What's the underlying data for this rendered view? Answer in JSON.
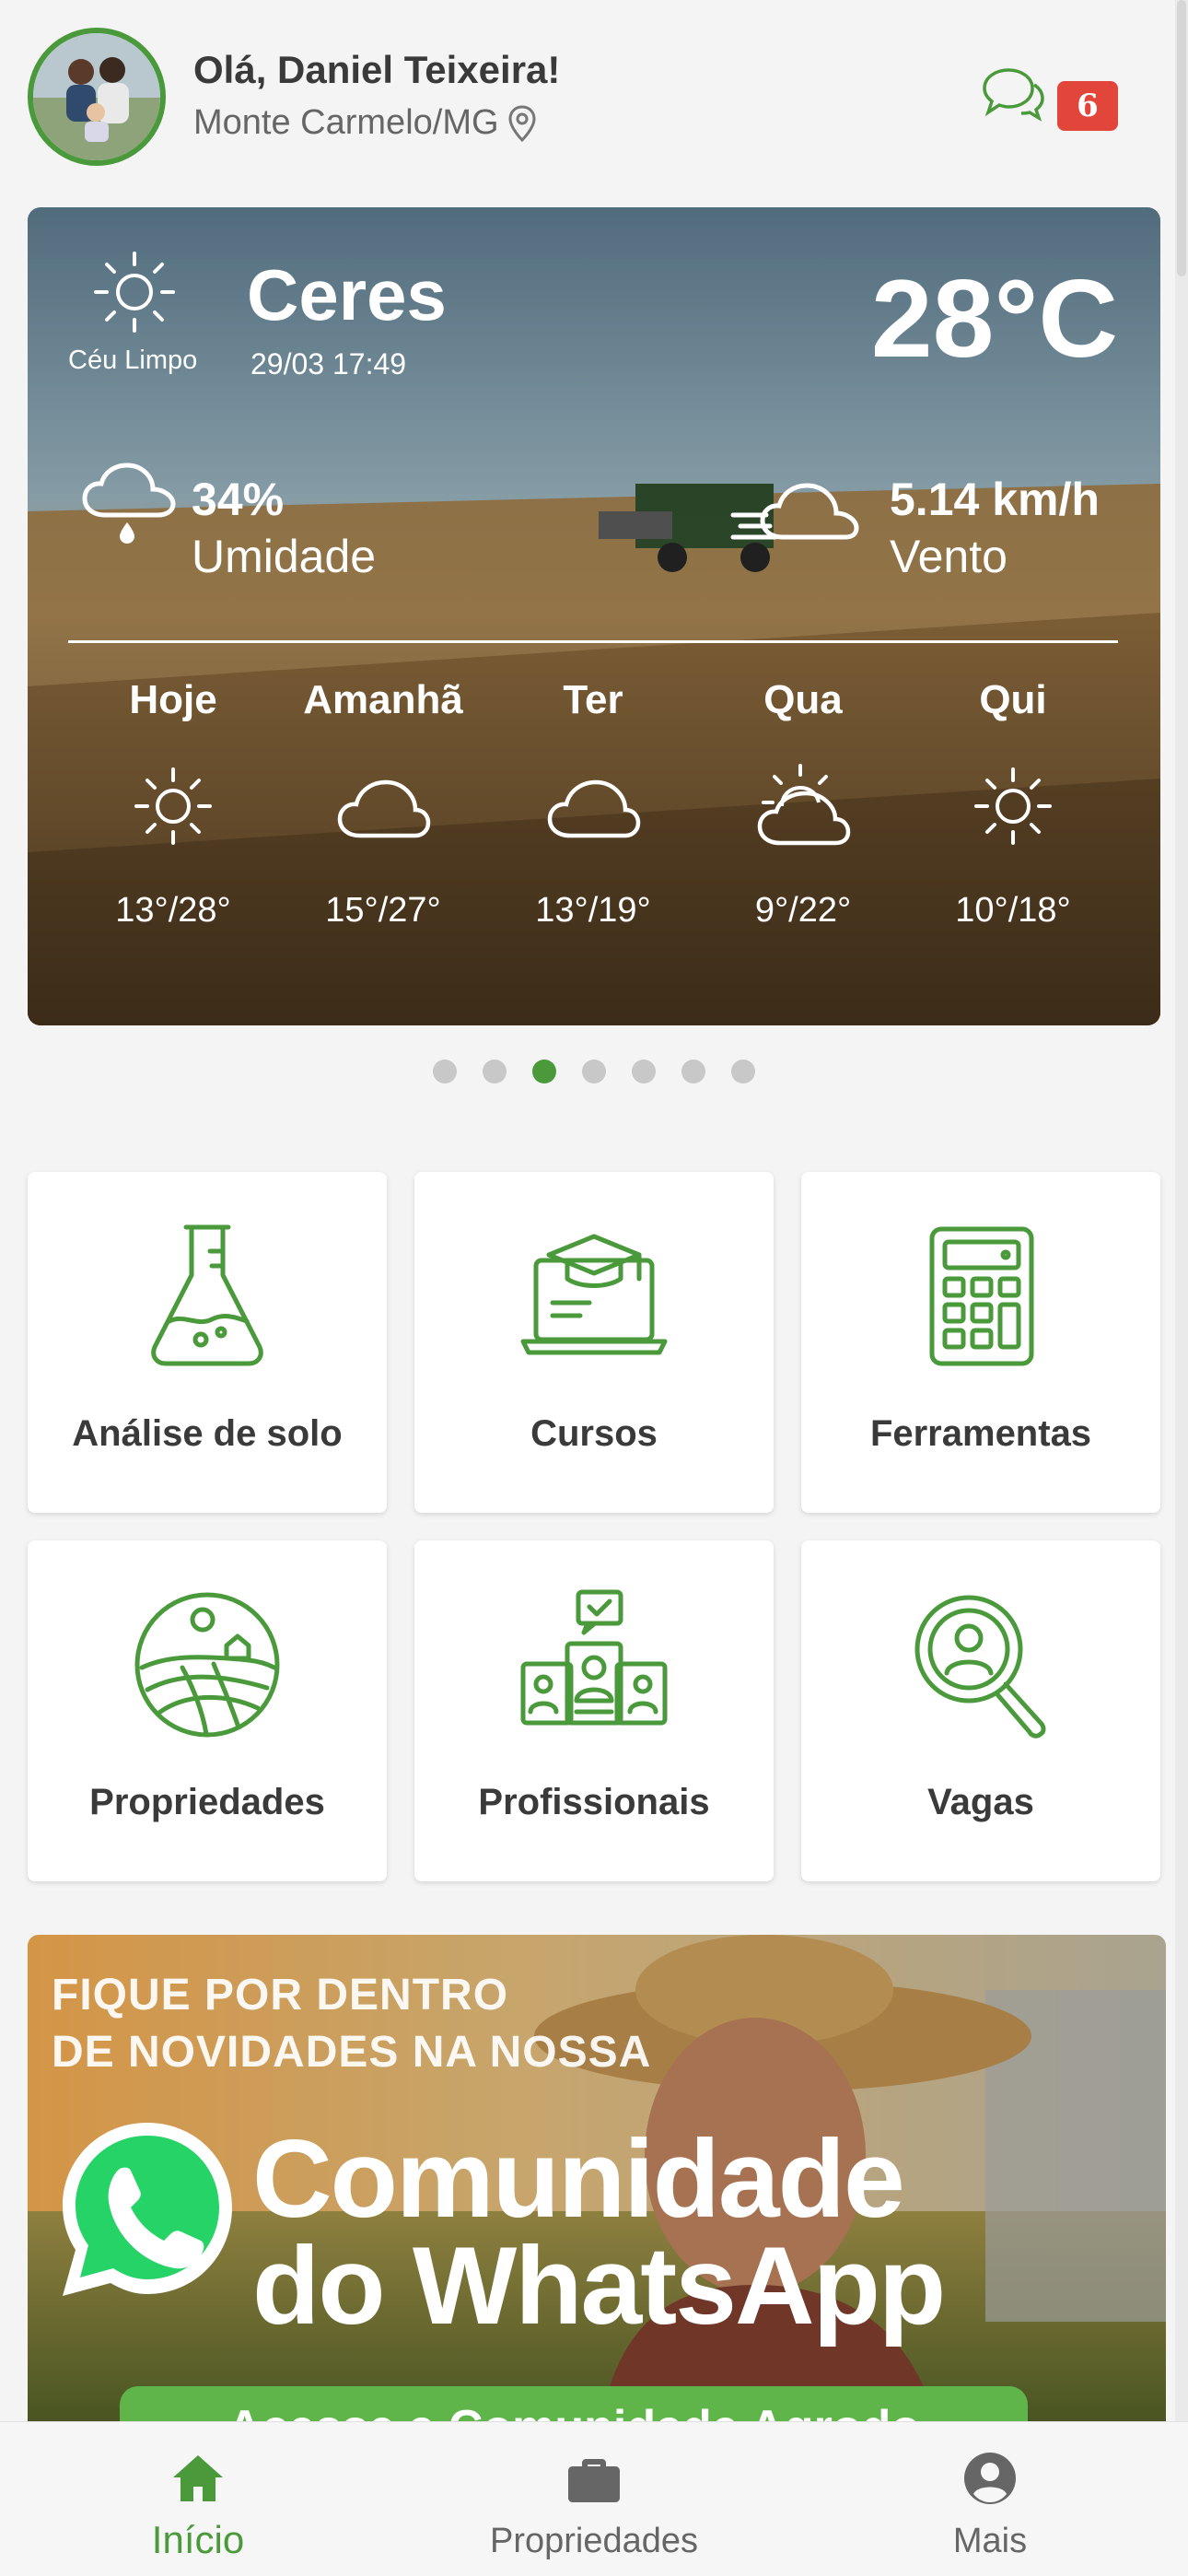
{
  "header": {
    "greeting": "Olá, Daniel Teixeira!",
    "location": "Monte Carmelo/MG",
    "message_count": "6"
  },
  "weather": {
    "current_condition": "Céu Limpo",
    "city": "Ceres",
    "datetime": "29/03 17:49",
    "temperature": "28°C",
    "humidity_value": "34%",
    "humidity_label": "Umidade",
    "wind_value": "5.14 km/h",
    "wind_label": "Vento",
    "forecast": [
      {
        "day": "Hoje",
        "icon": "sun-icon",
        "temps": "13°/28°"
      },
      {
        "day": "Amanhã",
        "icon": "cloud-icon",
        "temps": "15°/27°"
      },
      {
        "day": "Ter",
        "icon": "cloud-icon",
        "temps": "13°/19°"
      },
      {
        "day": "Qua",
        "icon": "partly-cloudy-icon",
        "temps": "9°/22°"
      },
      {
        "day": "Qui",
        "icon": "sun-icon",
        "temps": "10°/18°"
      }
    ]
  },
  "carousel": {
    "total": 7,
    "active_index": 2
  },
  "tiles": [
    {
      "label": "Análise de solo",
      "icon": "flask-icon"
    },
    {
      "label": "Cursos",
      "icon": "graduation-laptop-icon"
    },
    {
      "label": "Ferramentas",
      "icon": "calculator-icon"
    },
    {
      "label": "Propriedades",
      "icon": "farm-field-icon"
    },
    {
      "label": "Profissionais",
      "icon": "professionals-icon"
    },
    {
      "label": "Vagas",
      "icon": "search-person-icon"
    }
  ],
  "banner": {
    "line1": "FIQUE POR DENTRO",
    "line2": "DE NOVIDADES NA NOSSA",
    "title1": "Comunidade",
    "title2": "do WhatsApp",
    "button_label": "Acesse a Comunidade Agrodo"
  },
  "bottom_nav": [
    {
      "label": "Início",
      "icon": "home-icon",
      "active": true
    },
    {
      "label": "Propriedades",
      "icon": "briefcase-icon",
      "active": false
    },
    {
      "label": "Mais",
      "icon": "account-icon",
      "active": false
    }
  ],
  "colors": {
    "accent": "#4a9a3c",
    "badge": "#e2463b",
    "whatsapp": "#25d366"
  }
}
